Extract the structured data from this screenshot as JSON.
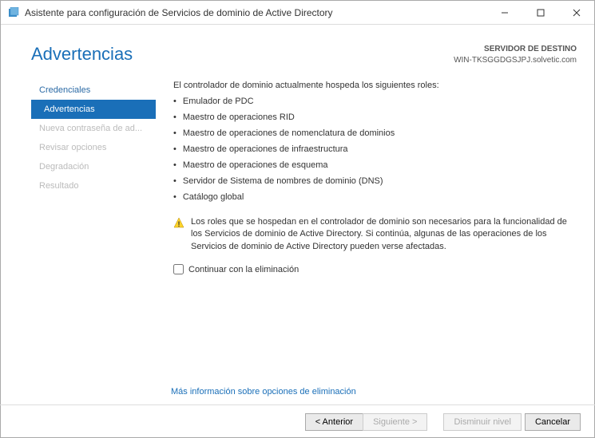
{
  "window": {
    "title": "Asistente para configuración de Servicios de dominio de Active Directory"
  },
  "header": {
    "page_title": "Advertencias",
    "destination_label": "SERVIDOR DE DESTINO",
    "destination_value": "WIN-TKSGGDGSJPJ.solvetic.com"
  },
  "sidebar": {
    "items": [
      {
        "label": "Credenciales",
        "state": "done"
      },
      {
        "label": "Advertencias",
        "state": "active"
      },
      {
        "label": "Nueva contraseña de ad...",
        "state": "disabled"
      },
      {
        "label": "Revisar opciones",
        "state": "disabled"
      },
      {
        "label": "Degradación",
        "state": "disabled"
      },
      {
        "label": "Resultado",
        "state": "disabled"
      }
    ]
  },
  "content": {
    "intro": "El controlador de dominio actualmente hospeda los siguientes roles:",
    "roles": [
      "Emulador de PDC",
      "Maestro de operaciones RID",
      "Maestro de operaciones de nomenclatura de dominios",
      "Maestro de operaciones de infraestructura",
      "Maestro de operaciones de esquema",
      "Servidor de Sistema de nombres de dominio (DNS)",
      "Catálogo global"
    ],
    "warning": "Los roles que se hospedan en el controlador de dominio son necesarios para la funcionalidad de los Servicios de dominio de Active Directory. Si continúa, algunas de las operaciones de los Servicios de dominio de Active Directory pueden verse afectadas.",
    "checkbox_label": "Continuar con la eliminación",
    "more_info": "Más información sobre opciones de eliminación"
  },
  "footer": {
    "previous": "< Anterior",
    "next": "Siguiente >",
    "demote": "Disminuir nivel",
    "cancel": "Cancelar"
  }
}
